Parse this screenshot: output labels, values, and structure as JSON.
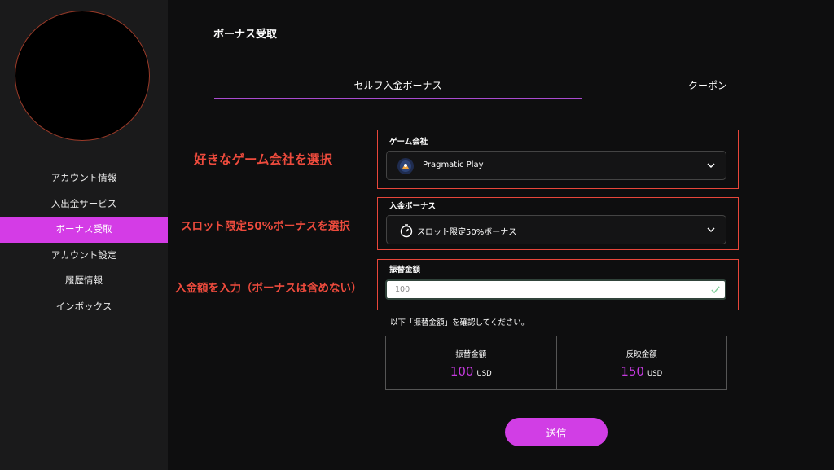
{
  "sidebar": {
    "items": [
      {
        "label": "アカウント情報"
      },
      {
        "label": "入出金サービス"
      },
      {
        "label": "ボーナス受取"
      },
      {
        "label": "アカウント設定"
      },
      {
        "label": "履歴情報"
      },
      {
        "label": "インボックス"
      }
    ],
    "active_index": 2,
    "active_color": "#d43ce6"
  },
  "main": {
    "title": "ボーナス受取",
    "tabs": [
      {
        "label": "セルフ入金ボーナス",
        "selected": true
      },
      {
        "label": "クーポン",
        "selected": false
      }
    ],
    "fields": {
      "provider": {
        "label": "ゲーム会社",
        "value": "Pragmatic Play",
        "icon": "pragmatic-play-logo-icon"
      },
      "bonus": {
        "label": "入金ボーナス",
        "value": "スロット限定50%ボーナス",
        "icon": "stopwatch-icon"
      },
      "amount": {
        "label": "振替金額",
        "value": "100",
        "icon": "check-icon"
      }
    },
    "confirm_note": "以下「振替金額」を確認してください。",
    "summary": {
      "transfer": {
        "label": "振替金額",
        "value": "100",
        "unit": "USD"
      },
      "reflected": {
        "label": "反映金額",
        "value": "150",
        "unit": "USD"
      }
    },
    "submit_label": "送信",
    "accent_color": "#d13ee5"
  },
  "annotations": {
    "provider": "好きなゲーム会社を選択",
    "bonus": "スロット限定50%ボーナスを選択",
    "amount": "入金額を入力（ボーナスは含めない）",
    "color": "#e8463a"
  }
}
